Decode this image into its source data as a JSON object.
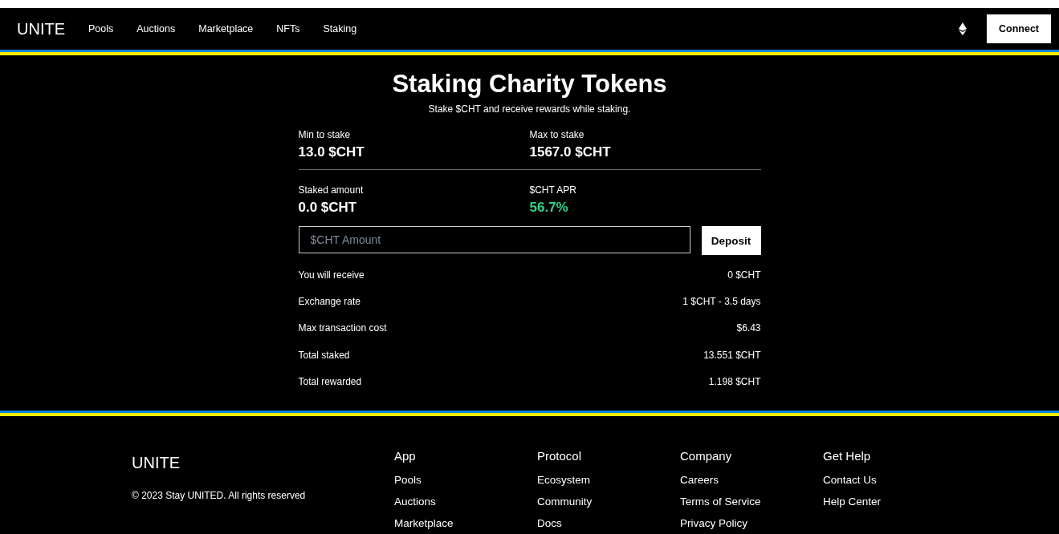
{
  "nav": {
    "logo": "UNITE",
    "links": [
      "Pools",
      "Auctions",
      "Marketplace",
      "NFTs",
      "Staking"
    ],
    "connect": "Connect"
  },
  "staking": {
    "title": "Staking Charity Tokens",
    "subtitle": "Stake $CHT and receive rewards while staking.",
    "stats": [
      {
        "label": "Min to stake",
        "value": "13.0 $CHT",
        "kind": "plain"
      },
      {
        "label": "Max to stake",
        "value": "1567.0 $CHT",
        "kind": "plain"
      },
      {
        "label": "Staked amount",
        "value": "0.0 $CHT",
        "kind": "plain"
      },
      {
        "label": "$CHT APR",
        "value": "56.7%",
        "kind": "positive"
      }
    ],
    "amount": {
      "placeholder": "$CHT Amount"
    },
    "deposit": "Deposit",
    "details": [
      {
        "label": "You will receive",
        "value": "0 $CHT"
      },
      {
        "label": "Exchange rate",
        "value": "1 $CHT - 3.5 days"
      },
      {
        "label": "Max transaction cost",
        "value": "$6.43"
      },
      {
        "label": "Total staked",
        "value": "13.551 $CHT"
      },
      {
        "label": "Total rewarded",
        "value": "1.198 $CHT"
      }
    ]
  },
  "footer": {
    "logo": "UNITE",
    "copyright": "© 2023 Stay UNITED. All rights reserved",
    "columns": [
      {
        "heading": "App",
        "links": [
          "Pools",
          "Auctions",
          "Marketplace"
        ]
      },
      {
        "heading": "Protocol",
        "links": [
          "Ecosystem",
          "Community",
          "Docs"
        ]
      },
      {
        "heading": "Company",
        "links": [
          "Careers",
          "Terms of Service",
          "Privacy Policy"
        ]
      },
      {
        "heading": "Get Help",
        "links": [
          "Contact Us",
          "Help Center"
        ]
      }
    ]
  }
}
